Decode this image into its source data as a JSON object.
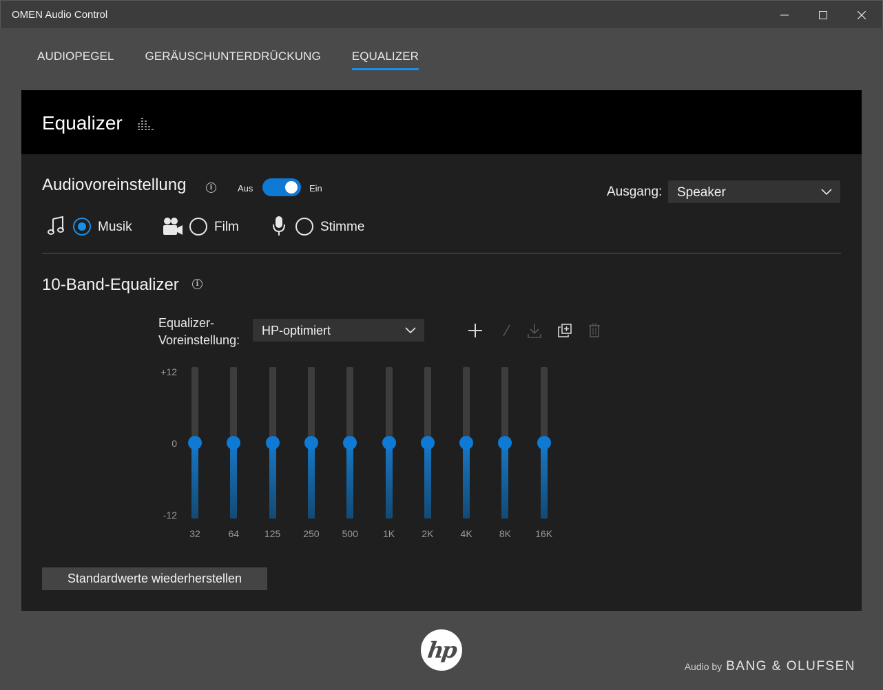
{
  "window": {
    "title": "OMEN Audio Control"
  },
  "tabs": [
    {
      "label": "AUDIOPEGEL",
      "active": false
    },
    {
      "label": "GERÄUSCHUNTERDRÜCKUNG",
      "active": false
    },
    {
      "label": "EQUALIZER",
      "active": true
    }
  ],
  "panel": {
    "title": "Equalizer",
    "icon": "equalizer-bars-icon"
  },
  "audio_preset": {
    "title": "Audiovoreinstellung",
    "toggle_off_label": "Aus",
    "toggle_on_label": "Ein",
    "toggle_state": "on",
    "output_label": "Ausgang:",
    "output_value": "Speaker",
    "modes": [
      {
        "label": "Musik",
        "icon": "music-note-icon",
        "selected": true
      },
      {
        "label": "Film",
        "icon": "video-camera-icon",
        "selected": false
      },
      {
        "label": "Stimme",
        "icon": "microphone-icon",
        "selected": false
      }
    ]
  },
  "band_eq": {
    "title": "10-Band-Equalizer",
    "preset_label_line1": "Equalizer-",
    "preset_label_line2": "Voreinstellung:",
    "preset_value": "HP-optimiert",
    "tools": [
      "plus-icon",
      "edit-icon",
      "download-icon",
      "duplicate-icon",
      "delete-icon"
    ],
    "scale": {
      "max": "+12",
      "mid": "0",
      "min": "-12"
    },
    "bands": [
      {
        "freq": "32",
        "gain": 0
      },
      {
        "freq": "64",
        "gain": 0
      },
      {
        "freq": "125",
        "gain": 0
      },
      {
        "freq": "250",
        "gain": 0
      },
      {
        "freq": "500",
        "gain": 0
      },
      {
        "freq": "1K",
        "gain": 0
      },
      {
        "freq": "2K",
        "gain": 0
      },
      {
        "freq": "4K",
        "gain": 0
      },
      {
        "freq": "8K",
        "gain": 0
      },
      {
        "freq": "16K",
        "gain": 0
      }
    ],
    "reset_label": "Standardwerte wiederherstellen"
  },
  "footer": {
    "logo": "hp",
    "audio_by": "Audio by",
    "brand": "BANG & OLUFSEN"
  },
  "colors": {
    "accent": "#0f7ad3",
    "panel": "#1f1f1f",
    "header": "#000000",
    "background": "#4a4a4a"
  }
}
